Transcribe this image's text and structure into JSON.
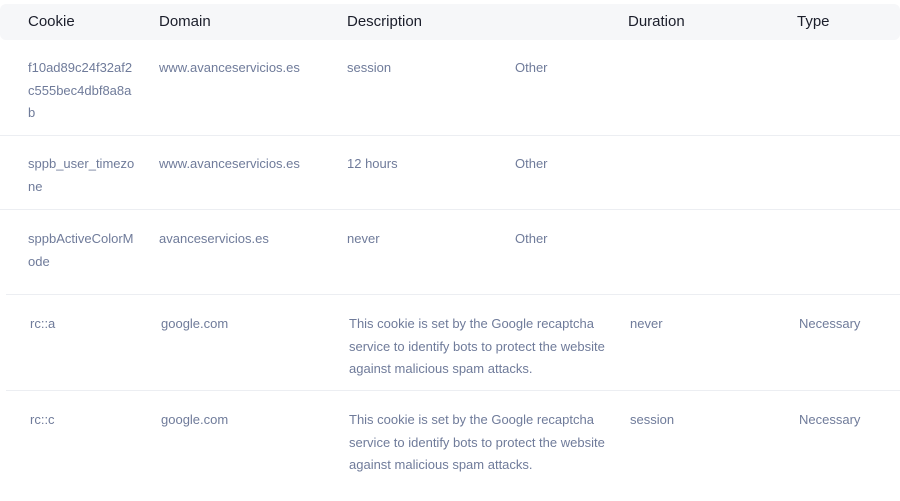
{
  "headers": {
    "cookie": "Cookie",
    "domain": "Domain",
    "description": "Description",
    "duration": "Duration",
    "type": "Type"
  },
  "rows": [
    {
      "cookie": "f10ad89c24f32af2c555bec4dbf8a8ab",
      "domain": "www.avanceservicios.es",
      "description": "session",
      "duration": "",
      "type": "Other"
    },
    {
      "cookie": "sppb_user_timezone",
      "domain": "www.avanceservicios.es",
      "description": "12 hours",
      "duration": "",
      "type": "Other"
    },
    {
      "cookie": "sppbActiveColorMode",
      "domain": "avanceservicios.es",
      "description": "never",
      "duration": "",
      "type": "Other"
    },
    {
      "cookie": "rc::a",
      "domain": "google.com",
      "description": "This cookie is set by the Google recaptcha service to identify bots to protect the website against malicious spam attacks.",
      "duration": "never",
      "type": "Necessary"
    },
    {
      "cookie": "rc::c",
      "domain": "google.com",
      "description": "This cookie is set by the Google recaptcha service to identify bots to protect the website against malicious spam attacks.",
      "duration": "session",
      "type": "Necessary"
    }
  ]
}
